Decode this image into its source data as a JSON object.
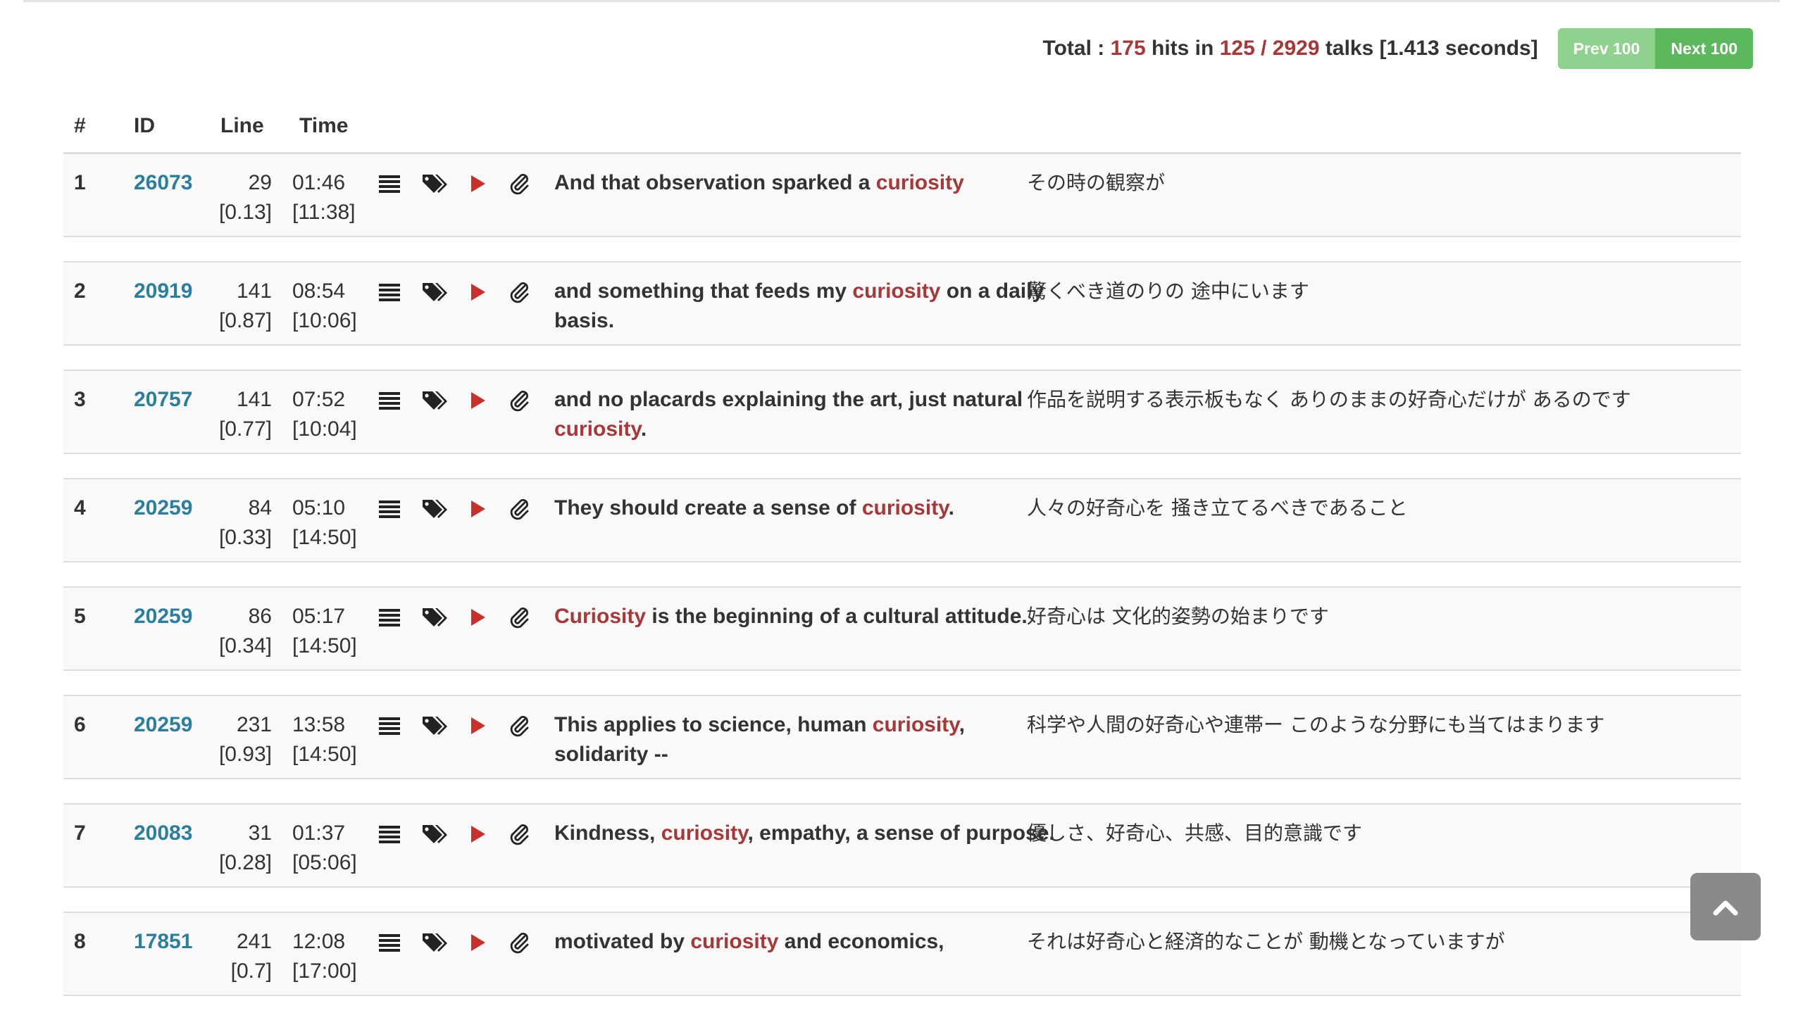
{
  "summary": {
    "total_label": "Total :",
    "hits": "175",
    "hits_suffix": "hits in",
    "talks_found": "125",
    "slash": "/",
    "talks_total": "2929",
    "talks_suffix": "talks",
    "time": "[1.413 seconds]"
  },
  "pager": {
    "prev_label": "Prev 100",
    "next_label": "Next 100"
  },
  "table": {
    "headers": {
      "num": "#",
      "id": "ID",
      "line": "Line",
      "time": "Time"
    },
    "rows": [
      {
        "num": "1",
        "id": "26073",
        "line": "29",
        "line_ratio": "[0.13]",
        "time": "01:46",
        "duration": "[11:38]",
        "en_before": "And that observation sparked a ",
        "en_kw": "curiosity",
        "en_after": "",
        "ja": "その時の観察が"
      },
      {
        "num": "2",
        "id": "20919",
        "line": "141",
        "line_ratio": "[0.87]",
        "time": "08:54",
        "duration": "[10:06]",
        "en_before": "and something that feeds my ",
        "en_kw": "curiosity",
        "en_after": " on a daily basis.",
        "ja": "驚くべき道のりの 途中にいます"
      },
      {
        "num": "3",
        "id": "20757",
        "line": "141",
        "line_ratio": "[0.77]",
        "time": "07:52",
        "duration": "[10:04]",
        "en_before": "and no placards explaining the art, just natural ",
        "en_kw": "curiosity",
        "en_after": ".",
        "ja": "作品を説明する表示板もなく ありのままの好奇心だけが あるのです"
      },
      {
        "num": "4",
        "id": "20259",
        "line": "84",
        "line_ratio": "[0.33]",
        "time": "05:10",
        "duration": "[14:50]",
        "en_before": "They should create a sense of ",
        "en_kw": "curiosity",
        "en_after": ".",
        "ja": "人々の好奇心を 掻き立てるべきであること"
      },
      {
        "num": "5",
        "id": "20259",
        "line": "86",
        "line_ratio": "[0.34]",
        "time": "05:17",
        "duration": "[14:50]",
        "en_before": "",
        "en_kw": "Curiosity",
        "en_after": " is the beginning of a cultural attitude.",
        "ja": "好奇心は 文化的姿勢の始まりです"
      },
      {
        "num": "6",
        "id": "20259",
        "line": "231",
        "line_ratio": "[0.93]",
        "time": "13:58",
        "duration": "[14:50]",
        "en_before": "This applies to science, human ",
        "en_kw": "curiosity",
        "en_after": ", solidarity --",
        "ja": "科学や人間の好奇心や連帯ー このような分野にも当てはまります"
      },
      {
        "num": "7",
        "id": "20083",
        "line": "31",
        "line_ratio": "[0.28]",
        "time": "01:37",
        "duration": "[05:06]",
        "en_before": "Kindness, ",
        "en_kw": "curiosity",
        "en_after": ", empathy, a sense of purpose.",
        "ja": "優しさ、好奇心、共感、目的意識です"
      },
      {
        "num": "8",
        "id": "17851",
        "line": "241",
        "line_ratio": "[0.7]",
        "time": "12:08",
        "duration": "[17:00]",
        "en_before": "motivated by ",
        "en_kw": "curiosity",
        "en_after": " and economics,",
        "ja": "それは好奇心と経済的なことが 動機となっていますが"
      }
    ]
  },
  "icons": {
    "transcript": "list-icon",
    "tags": "tags-icon",
    "play": "play-icon",
    "attachment": "paperclip-icon",
    "scroll_top": "chevron-up-icon"
  },
  "colors": {
    "keyword": "#a93737",
    "id_link": "#2a7f9e",
    "play": "#c9302c",
    "pager_prev": "#8fd18f",
    "pager_next": "#5cb85c",
    "row_bg": "#f9f9f9"
  }
}
